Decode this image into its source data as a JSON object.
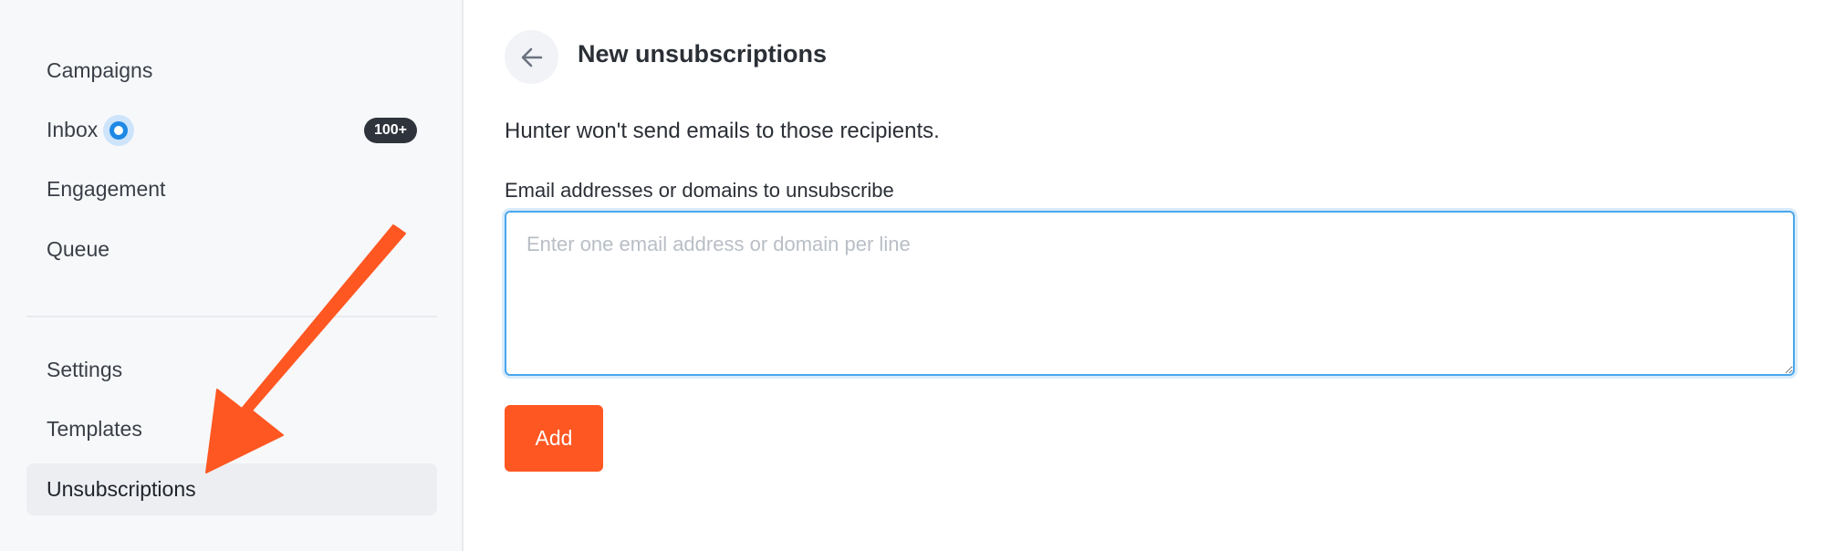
{
  "sidebar": {
    "items": [
      {
        "label": "Campaigns"
      },
      {
        "label": "Inbox",
        "badge": "100+"
      },
      {
        "label": "Engagement"
      },
      {
        "label": "Queue"
      },
      {
        "label": "Settings"
      },
      {
        "label": "Templates"
      },
      {
        "label": "Unsubscriptions",
        "active": true
      }
    ]
  },
  "main": {
    "title": "New unsubscriptions",
    "description": "Hunter won't send emails to those recipients.",
    "field_label": "Email addresses or domains to unsubscribe",
    "field_value": "",
    "field_placeholder": "Enter one email address or domain per line",
    "add_label": "Add"
  },
  "icons": {
    "back": "arrow-left-icon",
    "inbox_status": "live-dot-icon",
    "annotation": "pointer-arrow"
  },
  "colors": {
    "accent": "#ff5722",
    "focus": "#4aa6ec",
    "live": "#1e88e5",
    "badge": "#2f343c",
    "annotation": "#ff5722"
  }
}
